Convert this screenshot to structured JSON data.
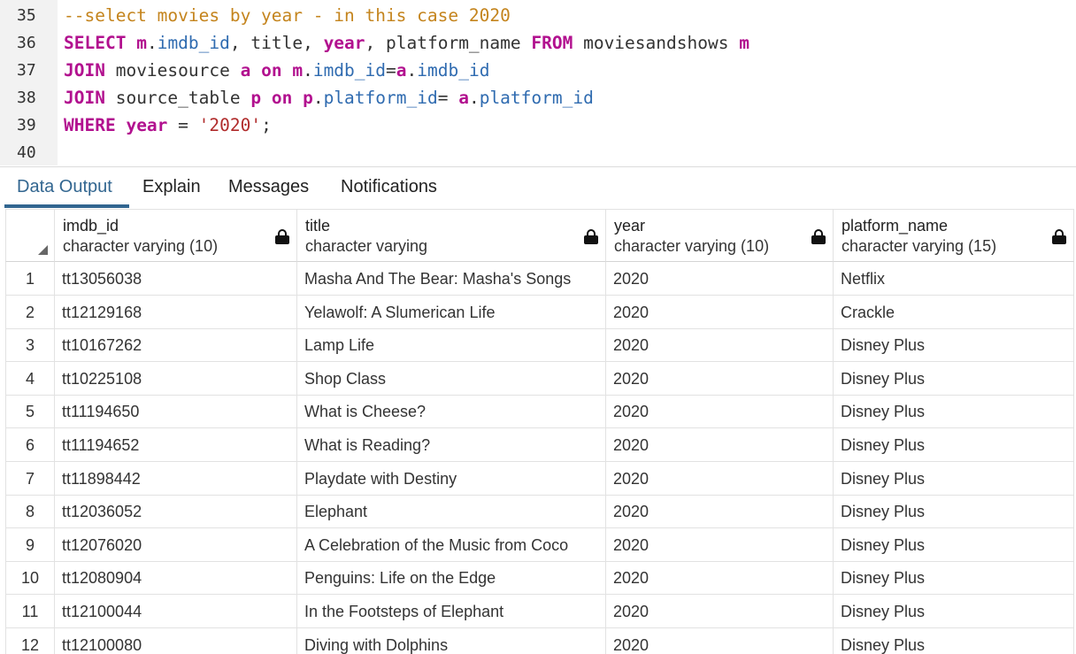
{
  "editor": {
    "lines": [
      {
        "num": "35",
        "tokens": [
          {
            "t": "--select movies by year - in this case 2020",
            "c": "cm"
          }
        ]
      },
      {
        "num": "36",
        "tokens": [
          {
            "t": "SELECT",
            "c": "kw"
          },
          {
            "t": " ",
            "c": "pl"
          },
          {
            "t": "m",
            "c": "kw"
          },
          {
            "t": ".",
            "c": "pl"
          },
          {
            "t": "imdb_id",
            "c": "id"
          },
          {
            "t": ", title, ",
            "c": "pl"
          },
          {
            "t": "year",
            "c": "kw"
          },
          {
            "t": ", platform_name ",
            "c": "pl"
          },
          {
            "t": "FROM",
            "c": "kw"
          },
          {
            "t": " moviesandshows ",
            "c": "pl"
          },
          {
            "t": "m",
            "c": "kw"
          }
        ]
      },
      {
        "num": "37",
        "tokens": [
          {
            "t": "JOIN",
            "c": "kw"
          },
          {
            "t": " moviesource ",
            "c": "pl"
          },
          {
            "t": "a",
            "c": "kw"
          },
          {
            "t": " ",
            "c": "pl"
          },
          {
            "t": "on",
            "c": "kw"
          },
          {
            "t": " ",
            "c": "pl"
          },
          {
            "t": "m",
            "c": "kw"
          },
          {
            "t": ".",
            "c": "pl"
          },
          {
            "t": "imdb_id",
            "c": "id"
          },
          {
            "t": "=",
            "c": "pl"
          },
          {
            "t": "a",
            "c": "kw"
          },
          {
            "t": ".",
            "c": "pl"
          },
          {
            "t": "imdb_id",
            "c": "id"
          }
        ]
      },
      {
        "num": "38",
        "tokens": [
          {
            "t": "JOIN",
            "c": "kw"
          },
          {
            "t": " source_table ",
            "c": "pl"
          },
          {
            "t": "p",
            "c": "kw"
          },
          {
            "t": " ",
            "c": "pl"
          },
          {
            "t": "on",
            "c": "kw"
          },
          {
            "t": " ",
            "c": "pl"
          },
          {
            "t": "p",
            "c": "kw"
          },
          {
            "t": ".",
            "c": "pl"
          },
          {
            "t": "platform_id",
            "c": "id"
          },
          {
            "t": "= ",
            "c": "pl"
          },
          {
            "t": "a",
            "c": "kw"
          },
          {
            "t": ".",
            "c": "pl"
          },
          {
            "t": "platform_id",
            "c": "id"
          }
        ]
      },
      {
        "num": "39",
        "tokens": [
          {
            "t": "WHERE",
            "c": "kw"
          },
          {
            "t": " ",
            "c": "pl"
          },
          {
            "t": "year",
            "c": "kw"
          },
          {
            "t": " = ",
            "c": "pl"
          },
          {
            "t": "'2020'",
            "c": "st"
          },
          {
            "t": ";",
            "c": "pl"
          }
        ]
      },
      {
        "num": "40",
        "tokens": []
      }
    ]
  },
  "tabs": [
    {
      "label": "Data Output",
      "active": true
    },
    {
      "label": "Explain",
      "active": false
    },
    {
      "label": "Messages",
      "active": false
    },
    {
      "label": "Notifications",
      "active": false
    }
  ],
  "grid": {
    "columns": [
      {
        "name": "imdb_id",
        "type": "character varying (10)",
        "icon": "lock-icon"
      },
      {
        "name": "title",
        "type": "character varying",
        "icon": "lock-icon"
      },
      {
        "name": "year",
        "type": "character varying (10)",
        "icon": "lock-icon"
      },
      {
        "name": "platform_name",
        "type": "character varying (15)",
        "icon": "lock-icon"
      }
    ],
    "rows": [
      {
        "n": "1",
        "cells": [
          "tt13056038",
          "Masha And The Bear: Masha's Songs",
          "2020",
          "Netflix"
        ]
      },
      {
        "n": "2",
        "cells": [
          "tt12129168",
          "Yelawolf: A Slumerican Life",
          "2020",
          "Crackle"
        ]
      },
      {
        "n": "3",
        "cells": [
          "tt10167262",
          "Lamp Life",
          "2020",
          "Disney Plus"
        ]
      },
      {
        "n": "4",
        "cells": [
          "tt10225108",
          "Shop Class",
          "2020",
          "Disney Plus"
        ]
      },
      {
        "n": "5",
        "cells": [
          "tt11194650",
          "What is Cheese?",
          "2020",
          "Disney Plus"
        ]
      },
      {
        "n": "6",
        "cells": [
          "tt11194652",
          "What is Reading?",
          "2020",
          "Disney Plus"
        ]
      },
      {
        "n": "7",
        "cells": [
          "tt11898442",
          "Playdate with Destiny",
          "2020",
          "Disney Plus"
        ]
      },
      {
        "n": "8",
        "cells": [
          "tt12036052",
          "Elephant",
          "2020",
          "Disney Plus"
        ]
      },
      {
        "n": "9",
        "cells": [
          "tt12076020",
          "A Celebration of the Music from Coco",
          "2020",
          "Disney Plus"
        ]
      },
      {
        "n": "10",
        "cells": [
          "tt12080904",
          "Penguins: Life on the Edge",
          "2020",
          "Disney Plus"
        ]
      },
      {
        "n": "11",
        "cells": [
          "tt12100044",
          "In the Footsteps of Elephant",
          "2020",
          "Disney Plus"
        ]
      },
      {
        "n": "12",
        "cells": [
          "tt12100080",
          "Diving with Dolphins",
          "2020",
          "Disney Plus"
        ]
      }
    ]
  },
  "colors": {
    "accent": "#326690",
    "keyword": "#b2118f",
    "identifier": "#2f6bb0",
    "comment": "#c4841d",
    "string": "#b02b2b"
  }
}
